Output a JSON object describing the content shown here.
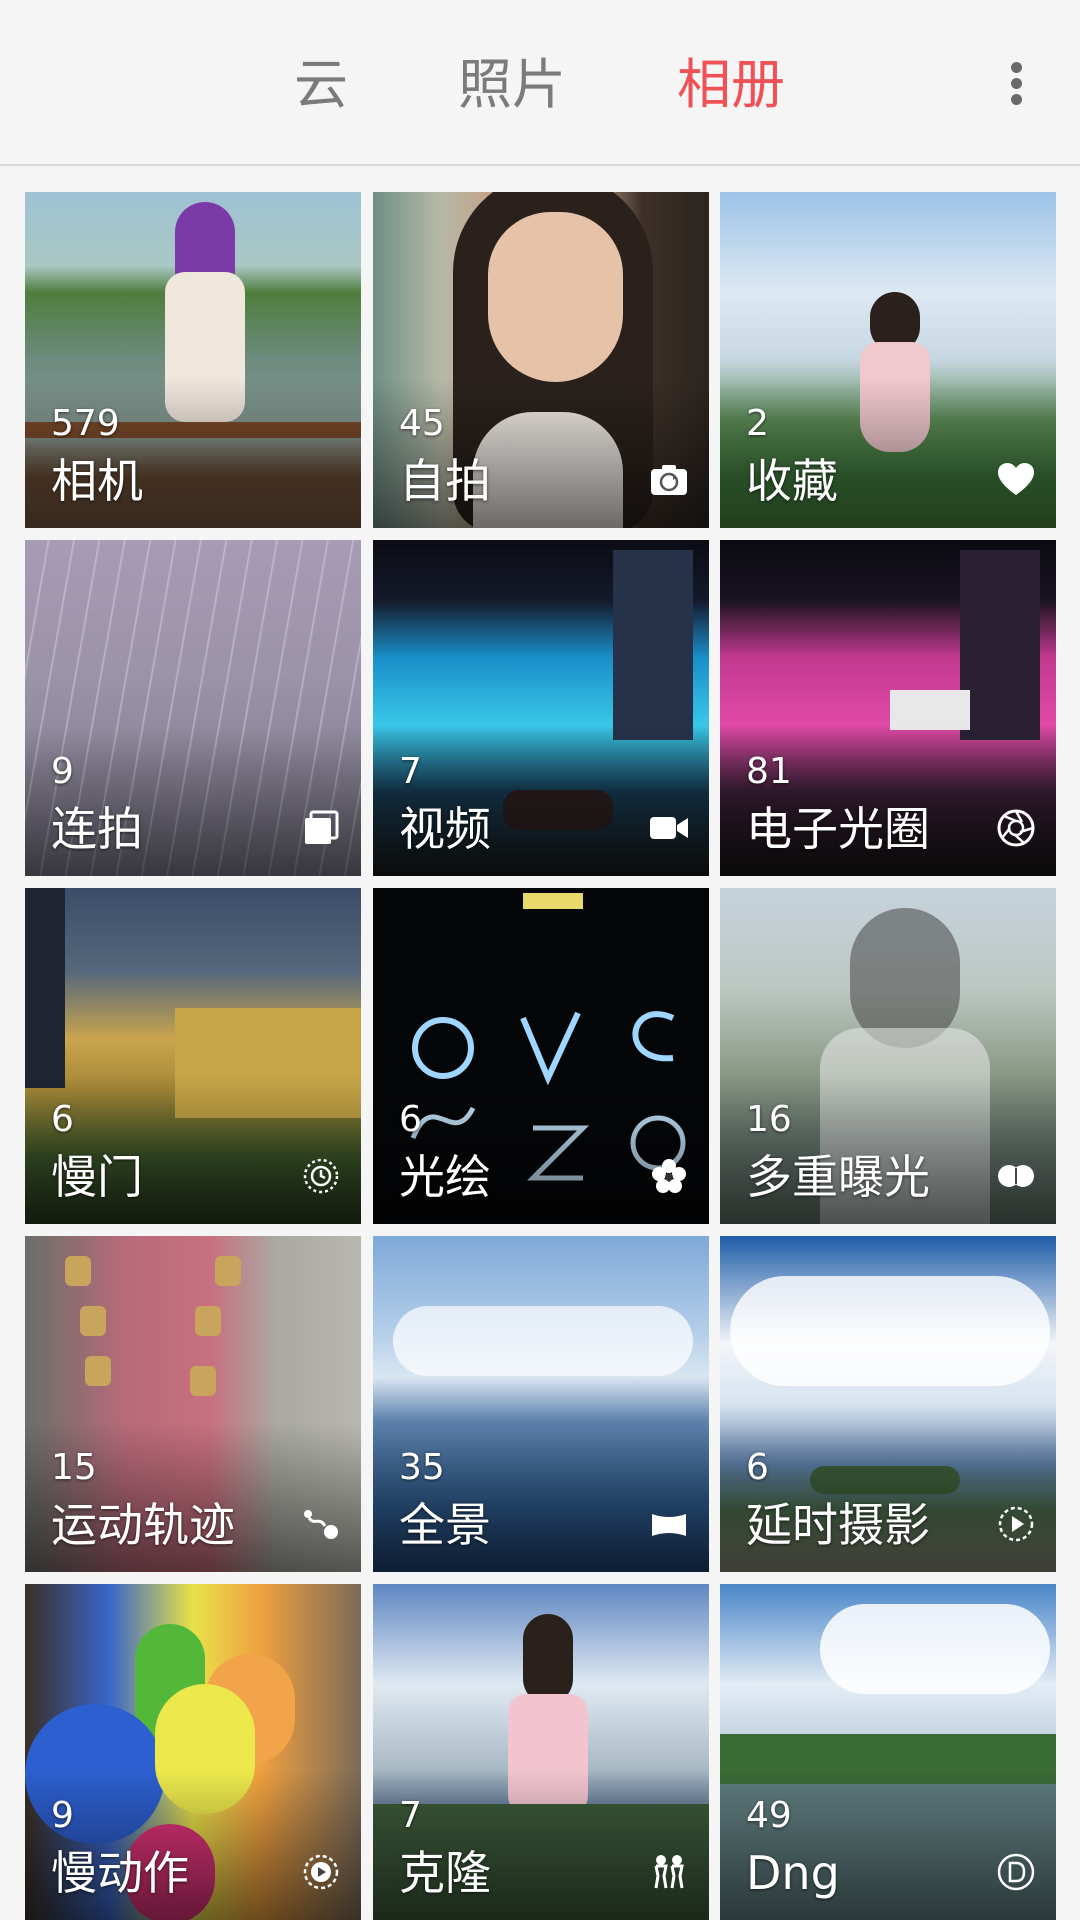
{
  "tabs": [
    {
      "label": "云",
      "active": false
    },
    {
      "label": "照片",
      "active": false
    },
    {
      "label": "相册",
      "active": true
    }
  ],
  "colors": {
    "accent": "#f05154",
    "tab_inactive": "#7b7b7b",
    "header_bg": "#f5f5f5"
  },
  "albums": [
    {
      "count": "579",
      "name": "相机",
      "icon": null
    },
    {
      "count": "45",
      "name": "自拍",
      "icon": "camera-switch-icon"
    },
    {
      "count": "2",
      "name": "收藏",
      "icon": "heart-icon"
    },
    {
      "count": "9",
      "name": "连拍",
      "icon": "burst-stack-icon"
    },
    {
      "count": "7",
      "name": "视频",
      "icon": "video-camera-icon"
    },
    {
      "count": "81",
      "name": "电子光圈",
      "icon": "aperture-icon"
    },
    {
      "count": "6",
      "name": "慢门",
      "icon": "slow-shutter-icon"
    },
    {
      "count": "6",
      "name": "光绘",
      "icon": "flower-icon"
    },
    {
      "count": "16",
      "name": "多重曝光",
      "icon": "double-exposure-icon"
    },
    {
      "count": "15",
      "name": "运动轨迹",
      "icon": "motion-trail-icon"
    },
    {
      "count": "35",
      "name": "全景",
      "icon": "panorama-icon"
    },
    {
      "count": "6",
      "name": "延时摄影",
      "icon": "timelapse-icon"
    },
    {
      "count": "9",
      "name": "慢动作",
      "icon": "slow-motion-icon"
    },
    {
      "count": "7",
      "name": "克隆",
      "icon": "clone-people-icon"
    },
    {
      "count": "49",
      "name": "Dng",
      "icon": "dng-icon"
    }
  ]
}
